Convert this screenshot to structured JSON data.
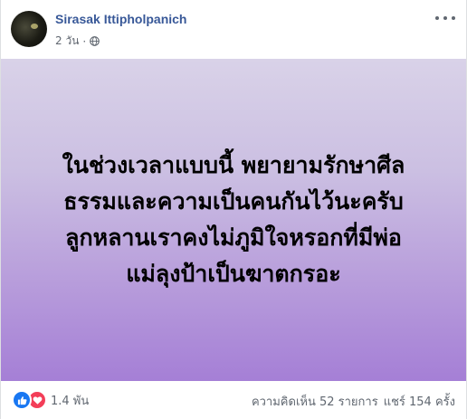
{
  "post": {
    "author": "Sirasak Ittipholpanich",
    "timestamp": "2 วัน",
    "separator": "·",
    "privacy_icon": "globe-icon",
    "status_text": "ในช่วงเวลาแบบนี้ พยายามรักษาศีล\nธรรมและความเป็นคนกันไว้นะครับ\nลูกหลานเราคงไม่ภูมิใจหรอกที่มีพ่อ\nแม่ลุงป้าเป็นฆาตกรอะ",
    "background_colors": [
      "#d9d2e8",
      "#a57fd6"
    ]
  },
  "footer": {
    "reaction_icons": [
      "like-icon",
      "love-icon"
    ],
    "reaction_count": "1.4 พัน",
    "comments": "ความคิดเห็น 52 รายการ",
    "shares": "แชร์ 154 ครั้ง"
  },
  "colors": {
    "author_link": "#385898",
    "like": "#1877f2",
    "love": "#f33e58",
    "meta_text": "#616770"
  }
}
